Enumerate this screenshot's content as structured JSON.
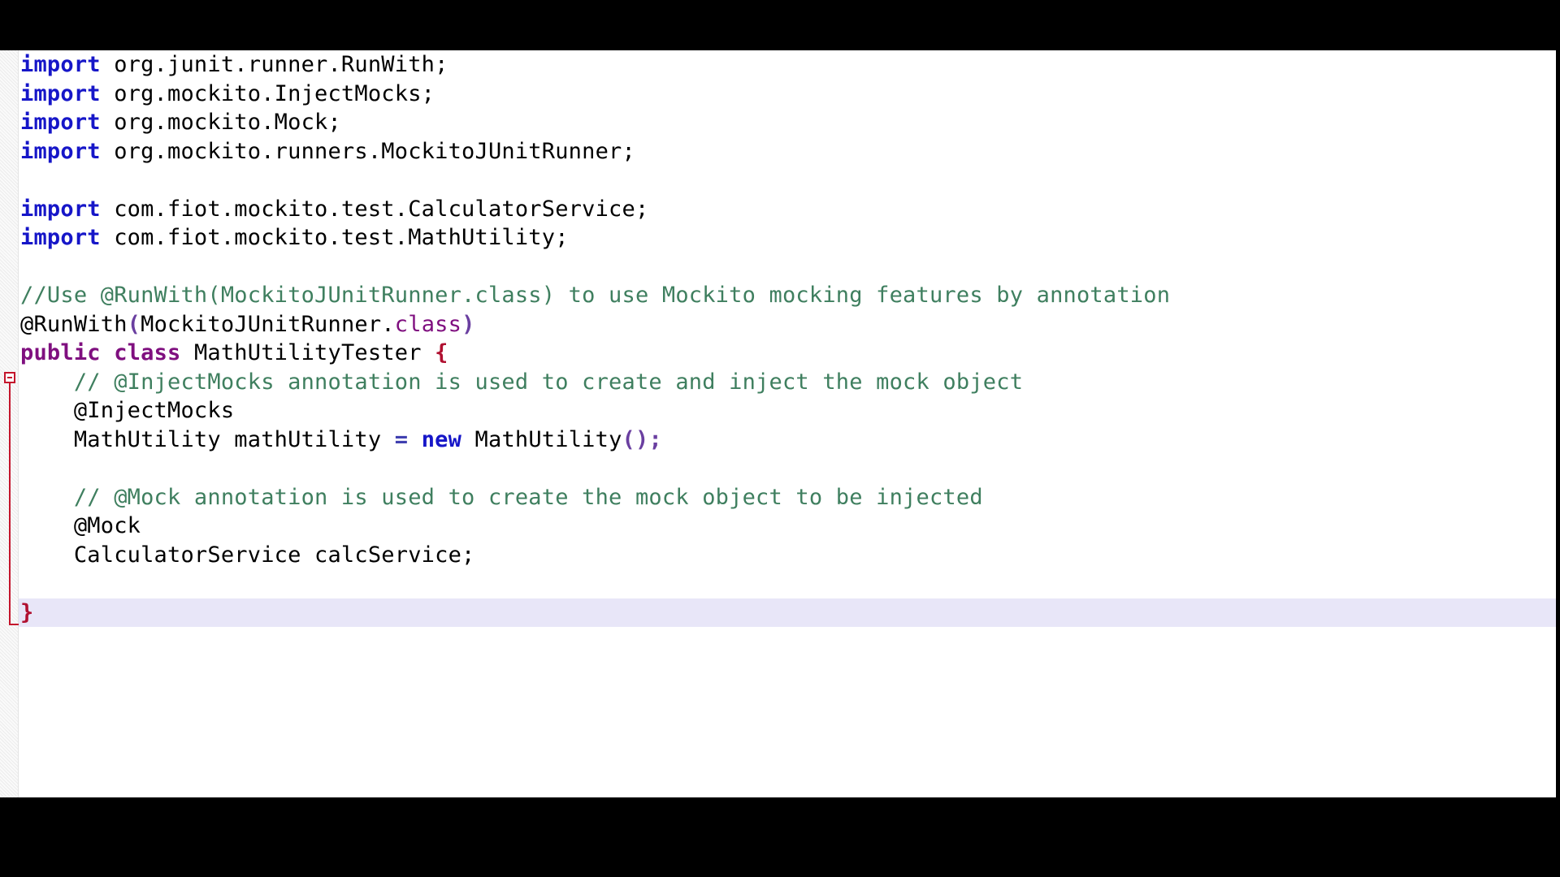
{
  "editor": {
    "language": "Java",
    "colors": {
      "background": "#ffffff",
      "keyword": "#1616c8",
      "comment": "#3f7f5f",
      "annotation_class": "#7f0f7f",
      "punctuation": "#6a3fa0",
      "brace": "#b01030",
      "fold_marker": "#c4152c",
      "current_line_highlight": "#e8e6f8",
      "gutter": "#f4f4f4",
      "letterbox": "#000000"
    },
    "fold_marker": "collapse-minus",
    "lines": [
      {
        "id": "line-import-runwith",
        "tokens": [
          {
            "t": "import",
            "c": "kw"
          },
          {
            "t": " org.junit.runner.RunWith;",
            "c": "plain"
          }
        ]
      },
      {
        "id": "line-import-injectmocks",
        "tokens": [
          {
            "t": "import",
            "c": "kw"
          },
          {
            "t": " org.mockito.InjectMocks;",
            "c": "plain"
          }
        ]
      },
      {
        "id": "line-import-mock",
        "tokens": [
          {
            "t": "import",
            "c": "kw"
          },
          {
            "t": " org.mockito.Mock;",
            "c": "plain"
          }
        ]
      },
      {
        "id": "line-import-mockitojunitrunner",
        "tokens": [
          {
            "t": "import",
            "c": "kw"
          },
          {
            "t": " org.mockito.runners.MockitoJUnitRunner;",
            "c": "plain"
          }
        ]
      },
      {
        "id": "line-blank-1",
        "tokens": []
      },
      {
        "id": "line-import-calculatorservice",
        "tokens": [
          {
            "t": "import",
            "c": "kw"
          },
          {
            "t": " com.fiot.mockito.test.CalculatorService;",
            "c": "plain"
          }
        ]
      },
      {
        "id": "line-import-mathutility",
        "tokens": [
          {
            "t": "import",
            "c": "kw"
          },
          {
            "t": " com.fiot.mockito.test.MathUtility;",
            "c": "plain"
          }
        ]
      },
      {
        "id": "line-blank-2",
        "tokens": []
      },
      {
        "id": "line-comment-runwith",
        "tokens": [
          {
            "t": "//Use @RunWith(MockitoJUnitRunner.class) to use Mockito mocking features by annotation",
            "c": "cmt"
          }
        ]
      },
      {
        "id": "line-annotation-runwith",
        "tokens": [
          {
            "t": "@RunWith",
            "c": "ann"
          },
          {
            "t": "(",
            "c": "punc"
          },
          {
            "t": "MockitoJUnitRunner.",
            "c": "plain"
          },
          {
            "t": "class",
            "c": "cls"
          },
          {
            "t": ")",
            "c": "punc"
          }
        ]
      },
      {
        "id": "line-class-declaration",
        "fold": true,
        "tokens": [
          {
            "t": "public",
            "c": "kw2"
          },
          {
            "t": " ",
            "c": "plain"
          },
          {
            "t": "class",
            "c": "kw2"
          },
          {
            "t": " MathUtilityTester ",
            "c": "plain"
          },
          {
            "t": "{",
            "c": "brace"
          }
        ]
      },
      {
        "id": "line-comment-injectmocks",
        "tokens": [
          {
            "t": "    // @InjectMocks annotation is used to create and inject the mock object",
            "c": "cmt"
          }
        ]
      },
      {
        "id": "line-annotation-injectmocks",
        "tokens": [
          {
            "t": "    @InjectMocks",
            "c": "ann"
          }
        ]
      },
      {
        "id": "line-field-mathutility",
        "tokens": [
          {
            "t": "    MathUtility mathUtility ",
            "c": "plain"
          },
          {
            "t": "=",
            "c": "op"
          },
          {
            "t": " ",
            "c": "plain"
          },
          {
            "t": "new",
            "c": "kw"
          },
          {
            "t": " MathUtility",
            "c": "plain"
          },
          {
            "t": "();",
            "c": "punc"
          }
        ]
      },
      {
        "id": "line-blank-3",
        "tokens": []
      },
      {
        "id": "line-comment-mock",
        "tokens": [
          {
            "t": "    // @Mock annotation is used to create the mock object to be injected",
            "c": "cmt"
          }
        ]
      },
      {
        "id": "line-annotation-mock",
        "tokens": [
          {
            "t": "    @Mock",
            "c": "ann"
          }
        ]
      },
      {
        "id": "line-field-calcservice",
        "tokens": [
          {
            "t": "    CalculatorService calcService;",
            "c": "plain"
          }
        ]
      },
      {
        "id": "line-blank-4",
        "tokens": []
      },
      {
        "id": "line-class-close",
        "current": true,
        "tokens": [
          {
            "t": "}",
            "c": "brace"
          }
        ]
      }
    ]
  }
}
